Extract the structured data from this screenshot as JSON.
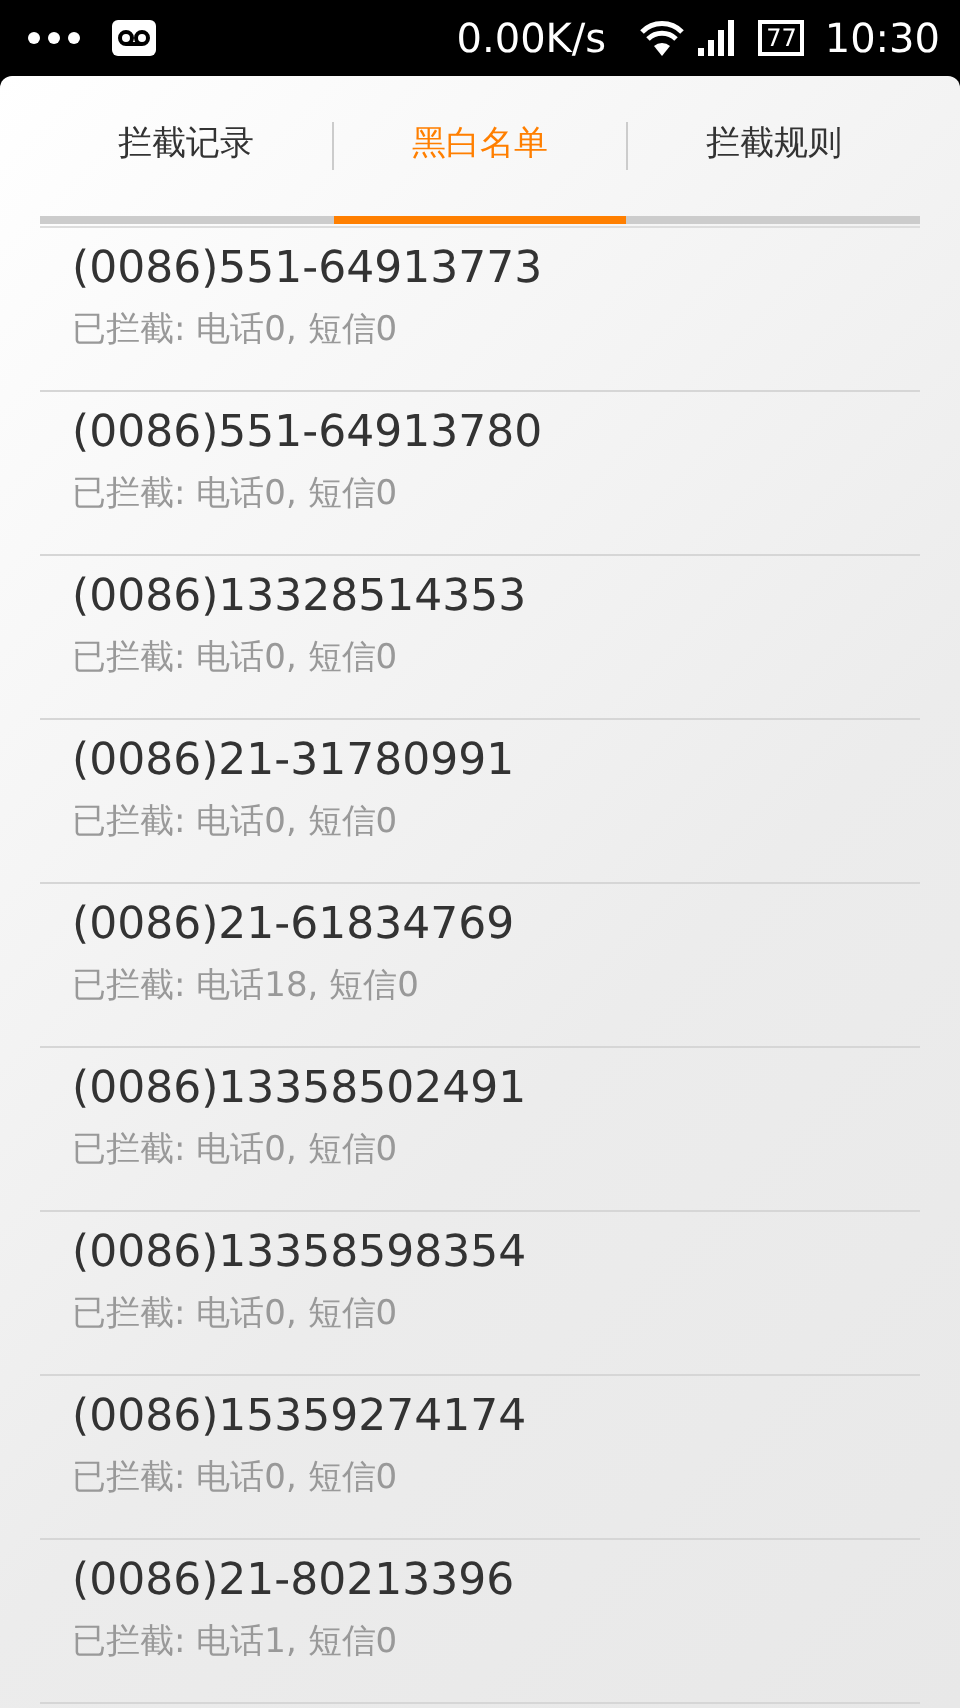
{
  "status_bar": {
    "network_speed": "0.00K/s",
    "battery": "77",
    "time": "10:30"
  },
  "tabs": [
    {
      "label": "拦截记录",
      "selected": false
    },
    {
      "label": "黑白名单",
      "selected": true
    },
    {
      "label": "拦截规则",
      "selected": false
    }
  ],
  "entries": [
    {
      "number": "(0086)551-64913773",
      "blocked": "已拦截: 电话0, 短信0"
    },
    {
      "number": "(0086)551-64913780",
      "blocked": "已拦截: 电话0, 短信0"
    },
    {
      "number": "(0086)13328514353",
      "blocked": "已拦截: 电话0, 短信0"
    },
    {
      "number": "(0086)21-31780991",
      "blocked": "已拦截: 电话0, 短信0"
    },
    {
      "number": "(0086)21-61834769",
      "blocked": "已拦截: 电话18, 短信0"
    },
    {
      "number": "(0086)13358502491",
      "blocked": "已拦截: 电话0, 短信0"
    },
    {
      "number": "(0086)13358598354",
      "blocked": "已拦截: 电话0, 短信0"
    },
    {
      "number": "(0086)15359274174",
      "blocked": "已拦截: 电话0, 短信0"
    },
    {
      "number": "(0086)21-80213396",
      "blocked": "已拦截: 电话1, 短信0"
    }
  ]
}
